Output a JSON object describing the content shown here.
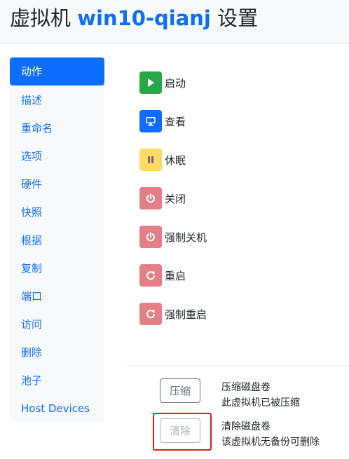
{
  "header": {
    "prefix": "虚拟机",
    "vm_name": "win10-qianj",
    "suffix": "设置"
  },
  "sidebar": {
    "items": [
      {
        "label": "动作",
        "active": true
      },
      {
        "label": "描述"
      },
      {
        "label": "重命名"
      },
      {
        "label": "选项"
      },
      {
        "label": "硬件"
      },
      {
        "label": "快照"
      },
      {
        "label": "根据"
      },
      {
        "label": "复制"
      },
      {
        "label": "端口"
      },
      {
        "label": "访问"
      },
      {
        "label": "删除"
      },
      {
        "label": "池子"
      },
      {
        "label": "Host Devices"
      }
    ]
  },
  "actions": [
    {
      "label": "启动",
      "icon": "play-icon",
      "color": "#28a745"
    },
    {
      "label": "查看",
      "icon": "monitor-icon",
      "color": "#0d6efd"
    },
    {
      "label": "休眠",
      "icon": "pause-icon",
      "color": "#ffd966"
    },
    {
      "label": "关闭",
      "icon": "power-icon",
      "color": "#e57f86"
    },
    {
      "label": "强制关机",
      "icon": "power-icon",
      "color": "#e57f86"
    },
    {
      "label": "重启",
      "icon": "restart-icon",
      "color": "#e57f86"
    },
    {
      "label": "强制重启",
      "icon": "restart-icon",
      "color": "#e57f86"
    }
  ],
  "disk": {
    "compress_button": "压缩",
    "compress_title": "压缩磁盘卷",
    "compress_status": "此虚拟机已被压缩",
    "clear_button": "清除",
    "clear_title": "清除磁盘卷",
    "clear_status": "该虚拟机无备份可删除"
  },
  "colors": {
    "primary": "#0d6efd",
    "success": "#28a745",
    "warning": "#ffd966",
    "danger": "#e57f86",
    "highlight": "#e31b1b"
  }
}
